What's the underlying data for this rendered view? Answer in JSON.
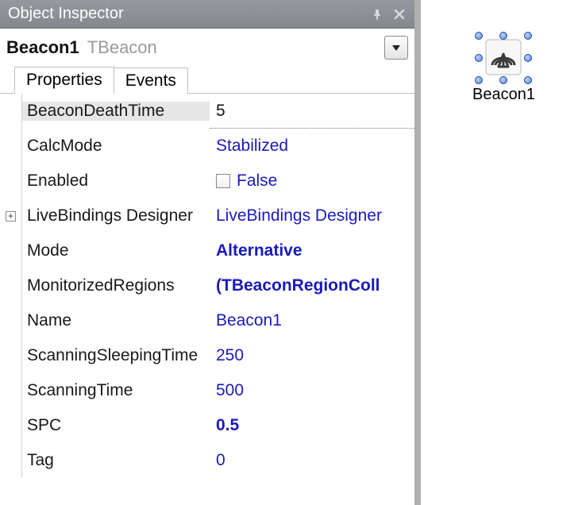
{
  "titlebar": {
    "title": "Object Inspector"
  },
  "selector": {
    "name": "Beacon1",
    "type": "TBeacon"
  },
  "tabs": {
    "properties": "Properties",
    "events": "Events"
  },
  "props": {
    "beaconDeathTime": {
      "label": "BeaconDeathTime",
      "value": "5"
    },
    "calcMode": {
      "label": "CalcMode",
      "value": "Stabilized"
    },
    "enabled": {
      "label": "Enabled",
      "value": "False"
    },
    "liveBindings": {
      "label": "LiveBindings Designer",
      "value": "LiveBindings Designer"
    },
    "mode": {
      "label": "Mode",
      "value": "Alternative"
    },
    "monitorizedRegions": {
      "label": "MonitorizedRegions",
      "value": "(TBeaconRegionColl"
    },
    "name": {
      "label": "Name",
      "value": "Beacon1"
    },
    "scanningSleepingTime": {
      "label": "ScanningSleepingTime",
      "value": "250"
    },
    "scanningTime": {
      "label": "ScanningTime",
      "value": "500"
    },
    "spc": {
      "label": "SPC",
      "value": "0.5"
    },
    "tag": {
      "label": "Tag",
      "value": "0"
    }
  },
  "designer": {
    "componentLabel": "Beacon1"
  }
}
